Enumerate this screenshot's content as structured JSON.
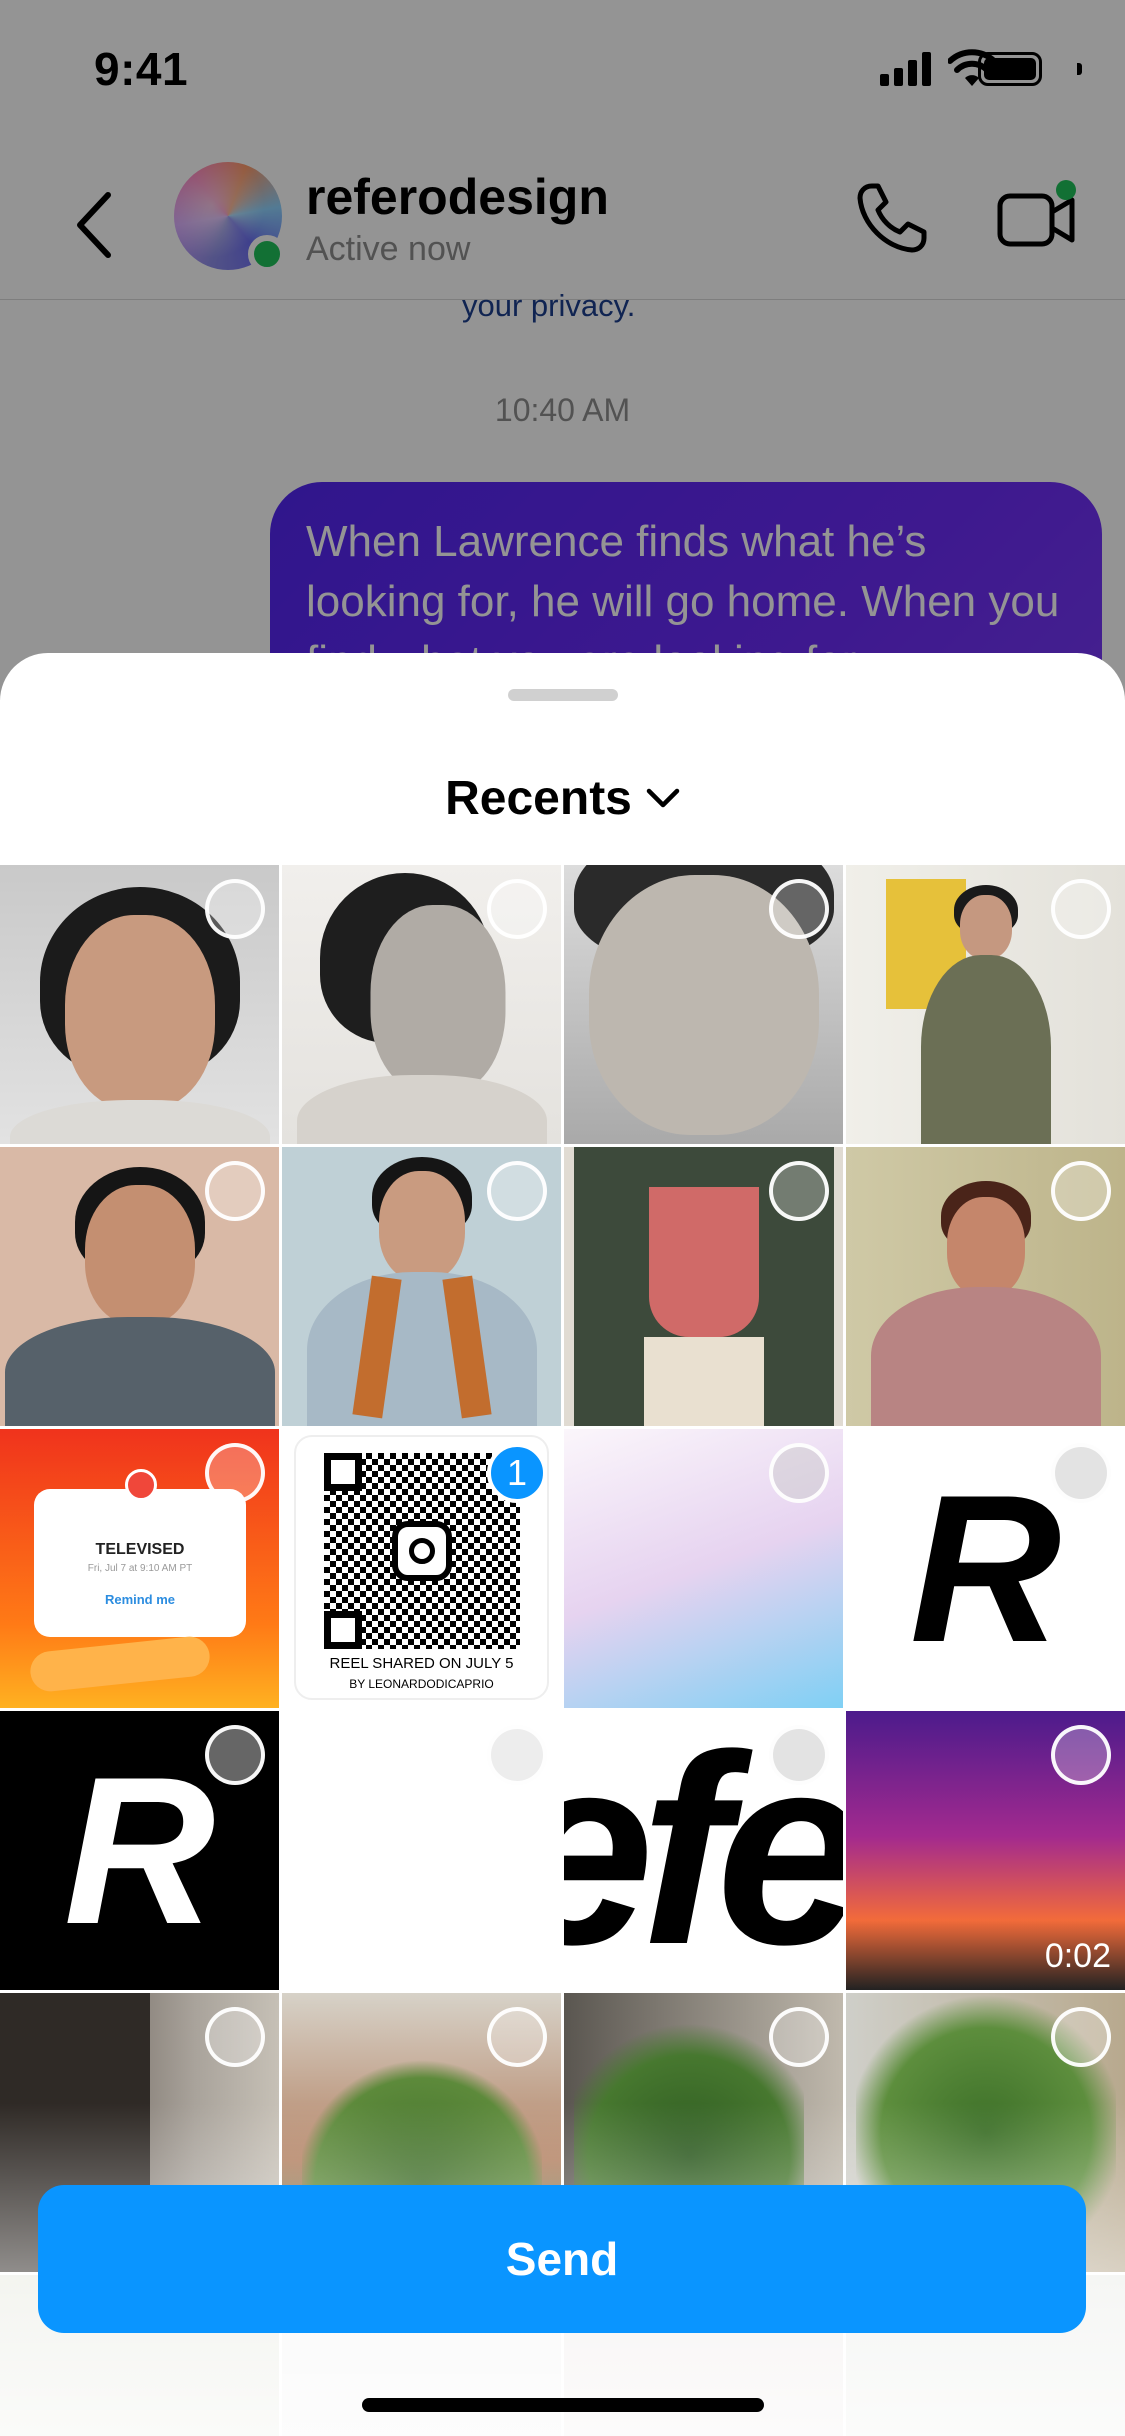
{
  "status_bar": {
    "time": "9:41"
  },
  "chat": {
    "username": "referodesign",
    "presence": "Active now",
    "privacy_snippet": "your privacy.",
    "timestamp": "10:40 AM",
    "message": "When Lawrence finds what he’s looking for, he will go home. When you find what you are looking for"
  },
  "sheet": {
    "album_title": "Recents",
    "selected_badge": "1",
    "video_duration": "0:02",
    "send_label": "Send",
    "qr_caption_line1": "REEL SHARED ON JULY 5",
    "qr_caption_line2": "BY LEONARDODICAPRIO",
    "story_title": "TELEVISED",
    "story_date": "Fri, Jul 7 at 9:10 AM PT",
    "story_button": "Remind me",
    "logo_letter": "R",
    "wordmark": "efe"
  },
  "colors": {
    "accent": "#0A95FF",
    "bubble": "#5A29F3",
    "online": "#1FC15B"
  }
}
